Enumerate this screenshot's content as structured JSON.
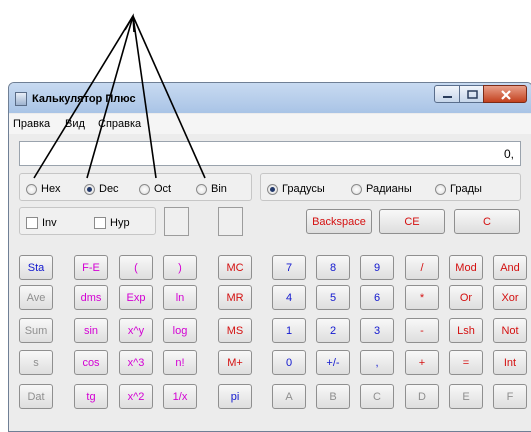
{
  "window": {
    "title": "Калькулятор Плюс"
  },
  "menu": [
    "Правка",
    "Вид",
    "Справка"
  ],
  "display": {
    "value": "0,"
  },
  "base_modes": [
    {
      "label": "Hex",
      "selected": false
    },
    {
      "label": "Dec",
      "selected": true
    },
    {
      "label": "Oct",
      "selected": false
    },
    {
      "label": "Bin",
      "selected": false
    }
  ],
  "angle_modes": [
    {
      "label": "Градусы",
      "selected": true
    },
    {
      "label": "Радианы",
      "selected": false
    },
    {
      "label": "Грады",
      "selected": false
    }
  ],
  "checkboxes": [
    {
      "label": "Inv",
      "checked": false
    },
    {
      "label": "Hyp",
      "checked": false
    }
  ],
  "edit_buttons": [
    "Backspace",
    "CE",
    "C"
  ],
  "buttons": [
    [
      "Sta",
      "F-E",
      "(",
      ")",
      "MC",
      "7",
      "8",
      "9",
      "/",
      "Mod",
      "And"
    ],
    [
      "Ave",
      "dms",
      "Exp",
      "ln",
      "MR",
      "4",
      "5",
      "6",
      "*",
      "Or",
      "Xor"
    ],
    [
      "Sum",
      "sin",
      "x^y",
      "log",
      "MS",
      "1",
      "2",
      "3",
      "-",
      "Lsh",
      "Not"
    ],
    [
      "s",
      "cos",
      "x^3",
      "n!",
      "M+",
      "0",
      "+/-",
      ",",
      "+",
      "=",
      "Int"
    ],
    [
      "Dat",
      "tg",
      "x^2",
      "1/x",
      "pi",
      "A",
      "B",
      "C",
      "D",
      "E",
      "F"
    ]
  ],
  "button_colors": [
    [
      "blue",
      "mag",
      "mag",
      "mag",
      "red",
      "blue",
      "blue",
      "blue",
      "red",
      "red",
      "red"
    ],
    [
      "gray",
      "mag",
      "mag",
      "mag",
      "red",
      "blue",
      "blue",
      "blue",
      "red",
      "red",
      "red"
    ],
    [
      "gray",
      "mag",
      "mag",
      "mag",
      "red",
      "blue",
      "blue",
      "blue",
      "red",
      "red",
      "red"
    ],
    [
      "gray",
      "mag",
      "mag",
      "mag",
      "red",
      "blue",
      "blue",
      "blue",
      "red",
      "red",
      "red"
    ],
    [
      "gray",
      "mag",
      "mag",
      "mag",
      "blue",
      "gray",
      "gray",
      "gray",
      "gray",
      "gray",
      "gray"
    ]
  ],
  "colors": {
    "blue": "#1218cf",
    "red": "#d41010",
    "magenta": "#d300d3",
    "disabled": "#8f8f8f"
  }
}
